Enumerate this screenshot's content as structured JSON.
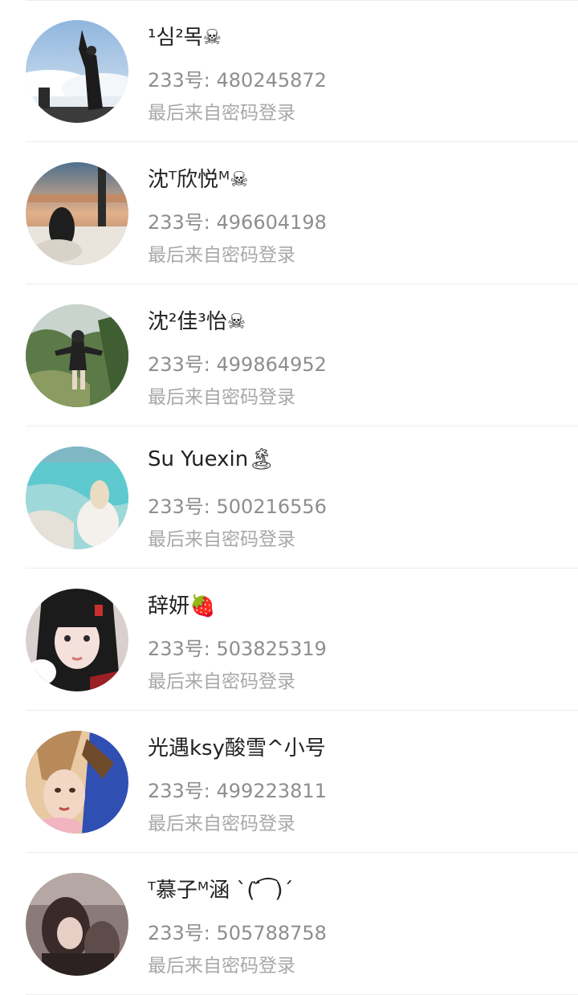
{
  "accounts": [
    {
      "name": "¹심²목☠",
      "uid": "233号: 480245872",
      "status": "最后来自密码登录"
    },
    {
      "name": "沈ᵀ欣悦ᴹ☠",
      "uid": "233号: 496604198",
      "status": "最后来自密码登录"
    },
    {
      "name": "沈²佳³怡☠",
      "uid": "233号: 499864952",
      "status": "最后来自密码登录"
    },
    {
      "name": "Su Yuexin🏝",
      "uid": "233号: 500216556",
      "status": "最后来自密码登录"
    },
    {
      "name": "辞妍🍓",
      "uid": "233号: 503825319",
      "status": "最后来自密码登录"
    },
    {
      "name": "光遇ksy酸雪^小号",
      "uid": "233号: 499223811",
      "status": "最后来自密码登录"
    },
    {
      "name": "ᵀ慕子ᴹ涵 ˋ( ̈́ ͡ )ˊ",
      "uid": "233号: 505788758",
      "status": "最后来自密码登录"
    }
  ],
  "colors": {
    "name": "#222222",
    "uid": "#8e8e8e",
    "status": "#a8a8a8",
    "divider": "#ececec"
  }
}
